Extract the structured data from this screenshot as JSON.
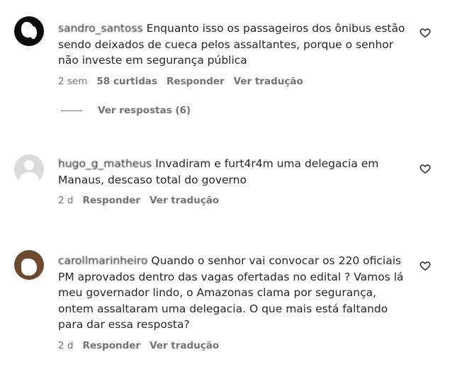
{
  "comments": [
    {
      "username": "sandro_santoss",
      "text": "Enquanto isso os passageiros dos ônibus estão sendo deixados de cueca pelos assaltantes, porque o senhor não investe em segurança pública",
      "time": "2 sem",
      "likes": "58 curtidas",
      "reply": "Responder",
      "translate": "Ver tradução",
      "view_replies": "Ver respostas (6)",
      "avatar": "avatar-redacted"
    },
    {
      "username": "hugo_g_matheus",
      "text": "Invadiram e furt4r4m uma delegacia em Manaus, descaso total do governo",
      "time": "2 d",
      "reply": "Responder",
      "translate": "Ver tradução",
      "avatar": "default-avatar"
    },
    {
      "username": "carollmarinheiro",
      "text": "Quando o senhor vai convocar os 220 oficiais PM aprovados dentro das vagas ofertadas no edital ? Vamos lá meu governador lindo, o Amazonas clama por segurança, ontem assaltaram uma delegacia. O que mais está faltando para dar essa resposta?",
      "time": "2 d",
      "reply": "Responder",
      "translate": "Ver tradução",
      "avatar": "avatar-redacted"
    }
  ],
  "icons": {
    "like": "heart-outline-icon"
  }
}
